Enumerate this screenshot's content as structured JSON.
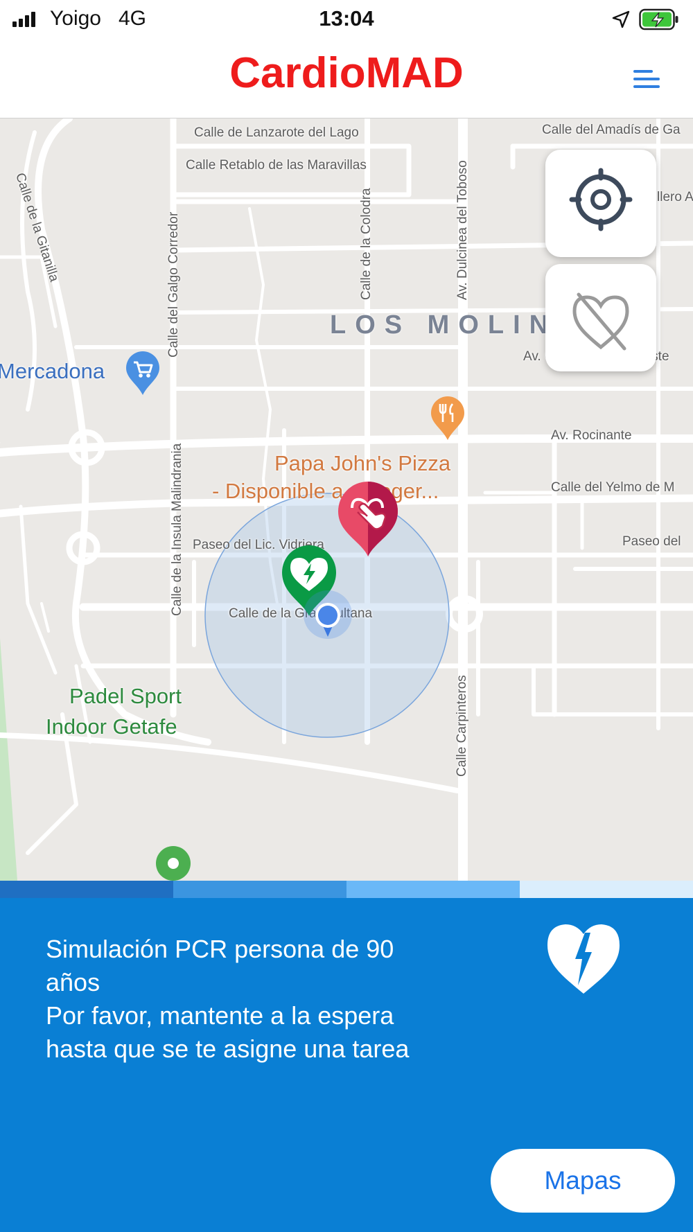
{
  "status_bar": {
    "carrier": "Yoigo",
    "network": "4G",
    "time": "13:04",
    "signal_icon": "signal-bars-icon",
    "location_icon": "location-arrow-icon",
    "battery_icon": "battery-charging-icon",
    "battery_color": "#3ec63b"
  },
  "header": {
    "title": "CardioMAD",
    "title_color": "#ee1c1c",
    "menu_icon": "hamburger-menu-icon",
    "accent": "#2f7fe0"
  },
  "map": {
    "district": "LOS MOLINOS",
    "streets": {
      "lanzarote": "Calle de Lanzarote del Lago",
      "retablo": "Calle Retablo de las Maravillas",
      "amadis": "Calle del Amadís de Ga",
      "gitanilla": "Calle de la Gitanilla",
      "galgo": "Calle del Galgo Corredor",
      "colodra": "Calle de la Colodra",
      "dulcinea": "Av. Dulcinea del Toboso",
      "caballero_triste": "Av. Caballero de la Triste",
      "rocinante": "Av. Rocinante",
      "yelmo": "Calle del Yelmo de M",
      "vidriera": "Paseo del Lic. Vidriera",
      "paseo_del": "Paseo del",
      "malindrania": "Calle de la Insula Malindrania",
      "sultana": "Calle de la Gran Sultana",
      "carpinteros": "Calle Carpinteros",
      "caballero_partial": "llero A"
    },
    "pois": {
      "mercadona": "Mercadona",
      "pizza_line1": "Papa John's Pizza",
      "pizza_line2": "- Disponible a recoger...",
      "padel_line1": "Padel Sport",
      "padel_line2": "Indoor Getafe"
    },
    "icons": {
      "shopping": "shopping-cart-pin-icon",
      "restaurant": "restaurant-pin-icon",
      "help": "helping-hand-heart-pin-icon",
      "dea": "defibrillator-pin-icon",
      "user": "user-location-dot-icon",
      "place": "green-place-pin-icon"
    },
    "buttons": {
      "locate_icon": "crosshair-locate-icon",
      "dea_toggle_icon": "heart-off-icon"
    }
  },
  "progress": {
    "segments": [
      "#1f6fc2",
      "#3b95e0",
      "#6ab8f7",
      "#dbeefc"
    ]
  },
  "panel": {
    "background": "#0a7fd4",
    "message_lines": [
      "Simulación PCR persona de 90",
      "años",
      "Por favor, mantente a la espera",
      "hasta que se te asigne una tarea"
    ],
    "icon": "heart-lightning-icon",
    "maps_button": "Mapas"
  }
}
